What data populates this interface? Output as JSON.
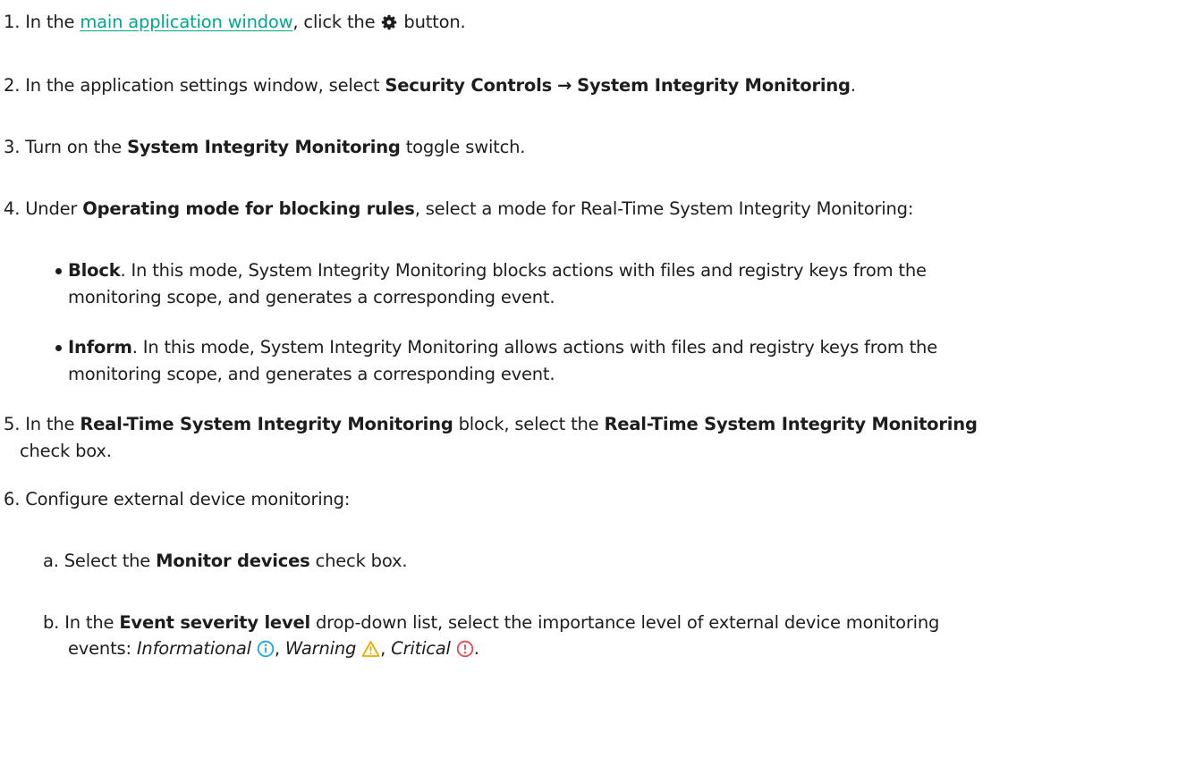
{
  "steps": {
    "s1": {
      "num": "1.",
      "pre": "In the",
      "link": "main application window",
      "mid": ", click the",
      "icon": "gear-icon",
      "post": "button."
    },
    "s2": {
      "num": "2.",
      "pre": "In the application settings window, select",
      "path_a": "Security Controls",
      "arrow": "→",
      "path_b": "System Integrity Monitoring",
      "post": "."
    },
    "s3": {
      "num": "3.",
      "pre": "Turn on the",
      "bold": "System Integrity Monitoring",
      "post": "toggle switch."
    },
    "s4": {
      "num": "4.",
      "pre": "Under",
      "bold": "Operating mode for blocking rules",
      "post": ", select a mode for Real-Time System Integrity Monitoring:"
    },
    "s4_block": {
      "bold": "Block",
      "line1": ". In this mode, System Integrity Monitoring blocks actions with files and registry keys from the",
      "line2": "monitoring scope, and generates a corresponding event."
    },
    "s4_inform": {
      "bold": "Inform",
      "line1": ". In this mode, System Integrity Monitoring allows actions with files and registry keys from the",
      "line2": "monitoring scope, and generates a corresponding event."
    },
    "s5": {
      "num": "5.",
      "pre": "In the",
      "bold1": "Real-Time System Integrity Monitoring",
      "mid": "block, select the",
      "bold2": "Real-Time System Integrity Monitoring",
      "line2": "check box."
    },
    "s6": {
      "num": "6.",
      "text": "Configure external device monitoring:"
    },
    "s6a": {
      "num": "a.",
      "pre": "Select the",
      "bold": "Monitor devices",
      "post": "check box."
    },
    "s6b": {
      "num": "b.",
      "pre": "In the",
      "bold": "Event severity level",
      "post": "drop-down list, select the importance level of external device monitoring",
      "line2_pre": "events:",
      "lvl1": "Informational",
      "lvl2": "Warning",
      "lvl3": "Critical",
      "sep": ",",
      "end": "."
    }
  },
  "colors": {
    "link": "#00a88e",
    "info": "#1fa4e8",
    "warning": "#f2a900",
    "critical": "#e5484d"
  },
  "icons": [
    "gear-icon",
    "info-icon",
    "warning-icon",
    "critical-icon"
  ]
}
